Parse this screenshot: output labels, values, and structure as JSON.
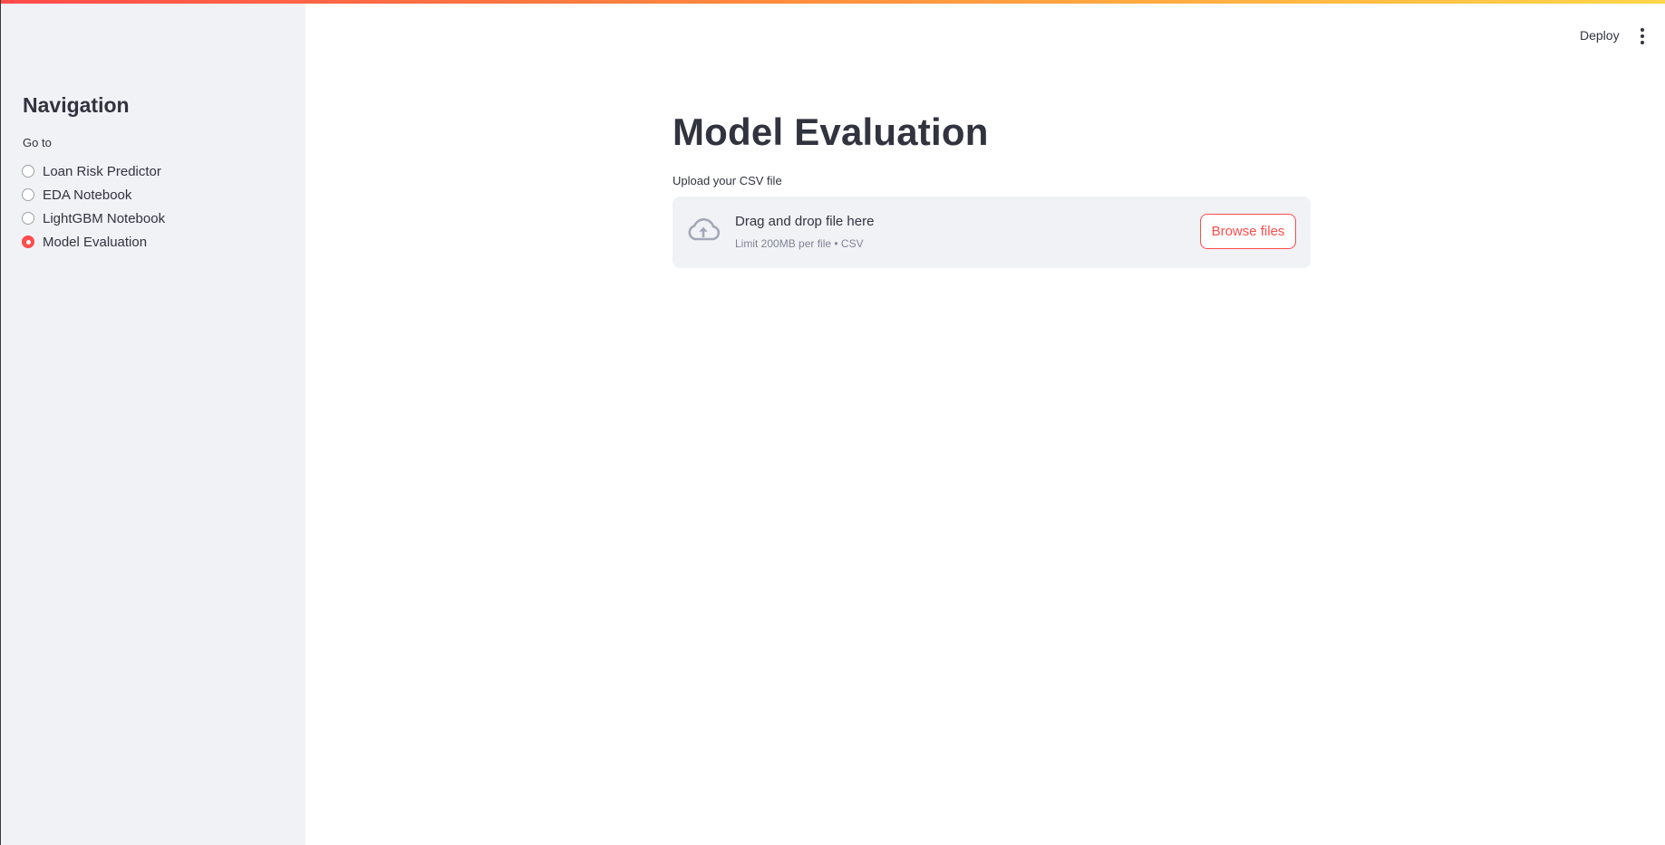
{
  "header": {
    "deploy_label": "Deploy",
    "menu_icon": "vertical-ellipsis-icon"
  },
  "sidebar": {
    "title": "Navigation",
    "radio_label": "Go to",
    "items": [
      {
        "label": "Loan Risk Predictor",
        "selected": false
      },
      {
        "label": "EDA Notebook",
        "selected": false
      },
      {
        "label": "LightGBM Notebook",
        "selected": false
      },
      {
        "label": "Model Evaluation",
        "selected": true
      }
    ]
  },
  "main": {
    "title": "Model Evaluation",
    "uploader": {
      "label": "Upload your CSV file",
      "drop_text": "Drag and drop file here",
      "limit_text": "Limit 200MB per file • CSV",
      "browse_label": "Browse files",
      "icon": "cloud-upload-icon"
    }
  },
  "colors": {
    "accent": "#ff4b4b",
    "sidebar_bg": "#f0f2f6",
    "text": "#31333f",
    "muted_text": "#808495"
  }
}
